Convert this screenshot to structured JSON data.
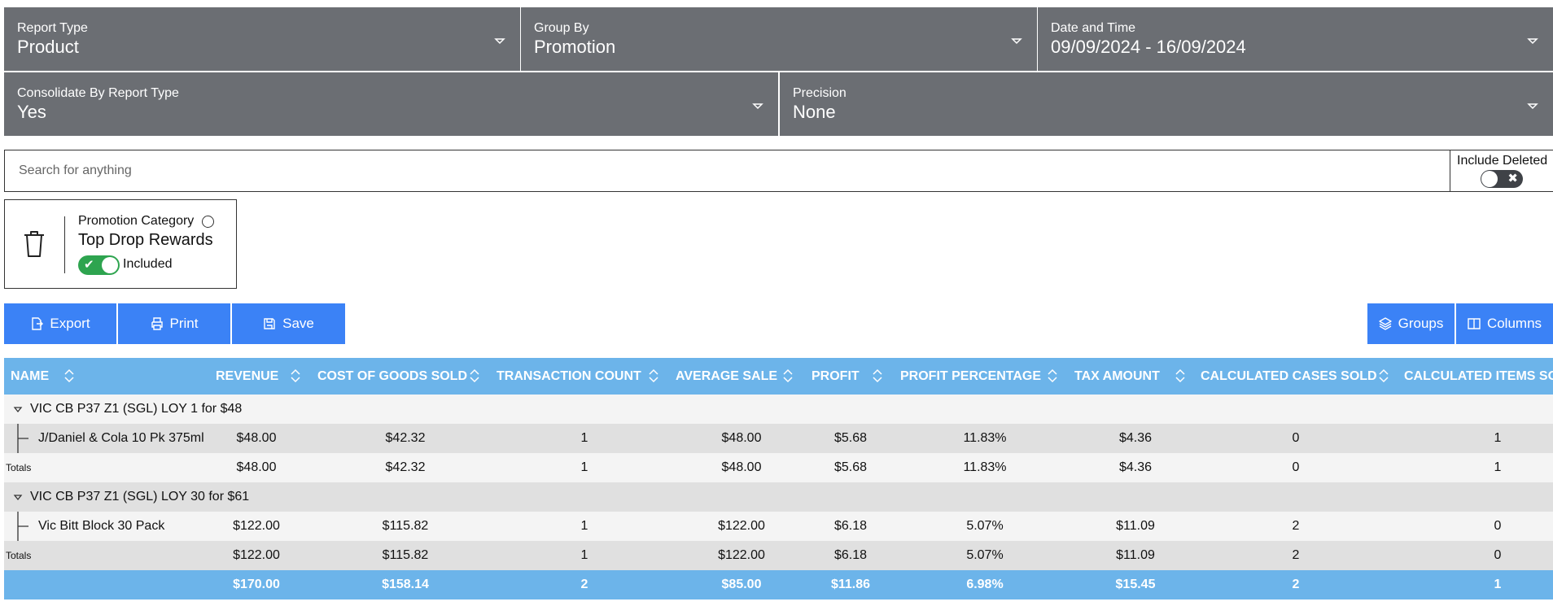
{
  "filters": {
    "report_type": {
      "label": "Report Type",
      "value": "Product"
    },
    "group_by": {
      "label": "Group By",
      "value": "Promotion"
    },
    "date_time": {
      "label": "Date and Time",
      "value": "09/09/2024 - 16/09/2024"
    },
    "consolidate": {
      "label": "Consolidate By Report Type",
      "value": "Yes"
    },
    "precision": {
      "label": "Precision",
      "value": "None"
    }
  },
  "search": {
    "placeholder": "Search for anything",
    "value": ""
  },
  "include_deleted": {
    "label": "Include Deleted",
    "on": false
  },
  "chip": {
    "category": "Promotion Category",
    "name": "Top Drop Rewards",
    "status": "Included",
    "on": true
  },
  "toolbar": {
    "export": "Export",
    "print": "Print",
    "save": "Save",
    "groups": "Groups",
    "columns": "Columns"
  },
  "colors": {
    "filter_bg": "#6b6e73",
    "button": "#3b82f6",
    "table_header": "#6cb4ea",
    "toggle_on": "#2ea44f"
  },
  "table": {
    "headers": [
      "NAME",
      "REVENUE",
      "COST OF GOODS SOLD",
      "TRANSACTION COUNT",
      "AVERAGE SALE",
      "PROFIT",
      "PROFIT PERCENTAGE",
      "TAX AMOUNT",
      "CALCULATED CASES SOLD",
      "CALCULATED ITEMS SOLD"
    ],
    "groups": [
      {
        "title": "VIC CB P37 Z1 (SGL) LOY 1 for $48",
        "item": {
          "name": "J/Daniel & Cola 10 Pk 375ml",
          "values": [
            "$48.00",
            "$42.32",
            "1",
            "$48.00",
            "$5.68",
            "11.83%",
            "$4.36",
            "0",
            "1"
          ]
        },
        "totals": {
          "label": "Totals",
          "values": [
            "$48.00",
            "$42.32",
            "1",
            "$48.00",
            "$5.68",
            "11.83%",
            "$4.36",
            "0",
            "1"
          ]
        }
      },
      {
        "title": "VIC CB P37 Z1 (SGL) LOY 30 for $61",
        "item": {
          "name": "Vic Bitt Block 30 Pack",
          "values": [
            "$122.00",
            "$115.82",
            "1",
            "$122.00",
            "$6.18",
            "5.07%",
            "$11.09",
            "2",
            "0"
          ]
        },
        "totals": {
          "label": "Totals",
          "values": [
            "$122.00",
            "$115.82",
            "1",
            "$122.00",
            "$6.18",
            "5.07%",
            "$11.09",
            "2",
            "0"
          ]
        }
      }
    ],
    "grand_totals": [
      "$170.00",
      "$158.14",
      "2",
      "$85.00",
      "$11.86",
      "6.98%",
      "$15.45",
      "2",
      "1"
    ]
  }
}
